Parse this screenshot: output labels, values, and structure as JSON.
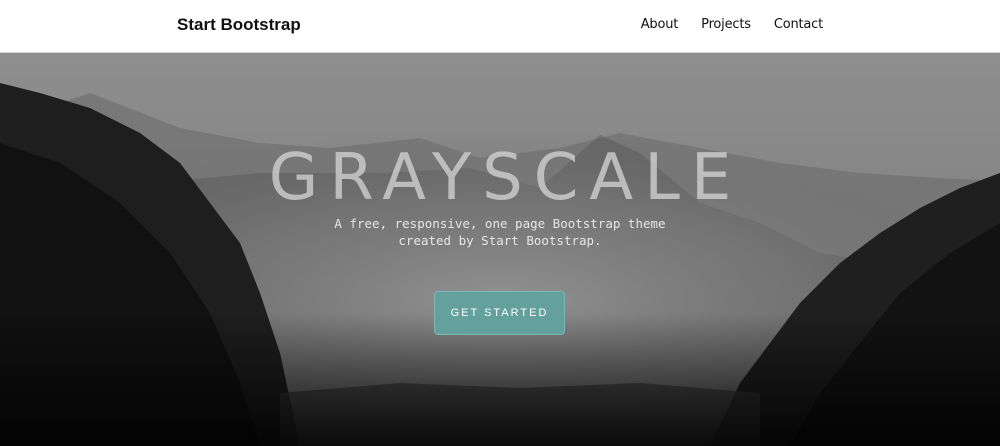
{
  "navbar": {
    "brand": "Start Bootstrap",
    "links": [
      "About",
      "Projects",
      "Contact"
    ]
  },
  "masthead": {
    "title": "GRAYSCALE",
    "subtitle_line1": "A free, responsive, one page Bootstrap theme",
    "subtitle_line2": "created by Start Bootstrap.",
    "cta_label": "GET STARTED"
  },
  "colors": {
    "accent": "#64a19d",
    "navbar_bg": "#ffffff"
  }
}
